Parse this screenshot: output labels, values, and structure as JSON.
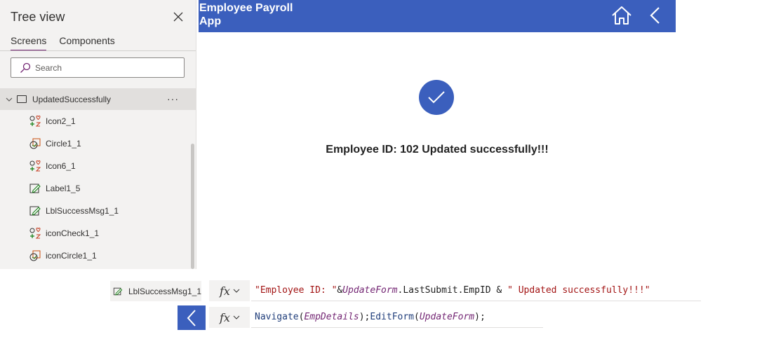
{
  "tree_view": {
    "title": "Tree view",
    "tabs": [
      {
        "label": "Screens",
        "active": true
      },
      {
        "label": "Components",
        "active": false
      }
    ],
    "search_placeholder": "Search",
    "screen": {
      "label": "UpdatedSuccessfully",
      "more_label": "···"
    },
    "items": [
      {
        "label": "Icon2_1",
        "icon": "icon-control-icon"
      },
      {
        "label": "Circle1_1",
        "icon": "shape-control-icon"
      },
      {
        "label": "Icon6_1",
        "icon": "icon-control-icon"
      },
      {
        "label": "Label1_5",
        "icon": "label-control-icon"
      },
      {
        "label": "LblSuccessMsg1_1",
        "icon": "label-control-icon"
      },
      {
        "label": "iconCheck1_1",
        "icon": "icon-control-icon"
      },
      {
        "label": "iconCircle1_1",
        "icon": "shape-control-icon"
      }
    ]
  },
  "app": {
    "title": "Employee Payroll App",
    "message": "Employee ID: 102 Updated successfully!!!",
    "colors": {
      "header": "#3b5fbd",
      "check_circle": "#3b5fbd"
    }
  },
  "formula_bars": {
    "control_name": "LblSuccessMsg1_1",
    "fx_label": "fx",
    "text_formula": {
      "str1": "\"Employee ID: \"",
      "amp1": "&",
      "ref1": "UpdateForm",
      "plain1": ".LastSubmit.EmpID & ",
      "str2": "\" Updated successfully!!!\""
    },
    "onselect_formula": {
      "fn1": "Navigate",
      "p1": "(",
      "ref1": "EmpDetails",
      "p2": ");",
      "fn2": "EditForm",
      "p3": "(",
      "ref2": "UpdateForm",
      "p4": ");"
    }
  }
}
